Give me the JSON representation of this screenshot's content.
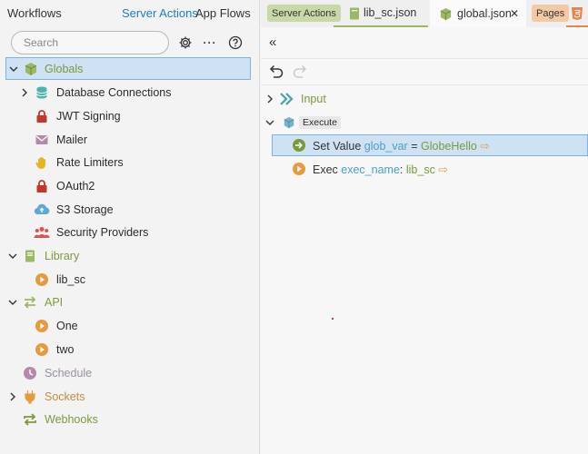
{
  "topnav": {
    "workflows": "Workflows",
    "server_actions": "Server Actions",
    "app_flows": "App Flows"
  },
  "search": {
    "placeholder": "Search"
  },
  "tree": {
    "globals": "Globals",
    "database_connections": "Database Connections",
    "jwt_signing": "JWT Signing",
    "mailer": "Mailer",
    "rate_limiters": "Rate Limiters",
    "oauth2": "OAuth2",
    "s3_storage": "S3 Storage",
    "security_providers": "Security Providers",
    "library": "Library",
    "lib_sc": "lib_sc",
    "api": "API",
    "one": "One",
    "two": "two",
    "schedule": "Schedule",
    "sockets": "Sockets",
    "webhooks": "Webhooks"
  },
  "tabs": {
    "server_actions": "Server Actions",
    "lib_file": "lib_sc.json",
    "global_file": "global.json",
    "pages": "Pages"
  },
  "editor": {
    "input": "Input",
    "execute": "Execute",
    "set_value_kw": "Set Value",
    "set_value_var": "glob_var",
    "set_value_eq": "=",
    "set_value_val": "GlobeHello",
    "exec_kw": "Exec",
    "exec_var": "exec_name",
    "exec_colon": ":",
    "exec_val": "lib_sc"
  },
  "colors": {
    "accent_blue": "#1a7fc1",
    "green": "#7a9a3a",
    "selection": "#cfe2f3",
    "orange": "#e69a3c"
  }
}
